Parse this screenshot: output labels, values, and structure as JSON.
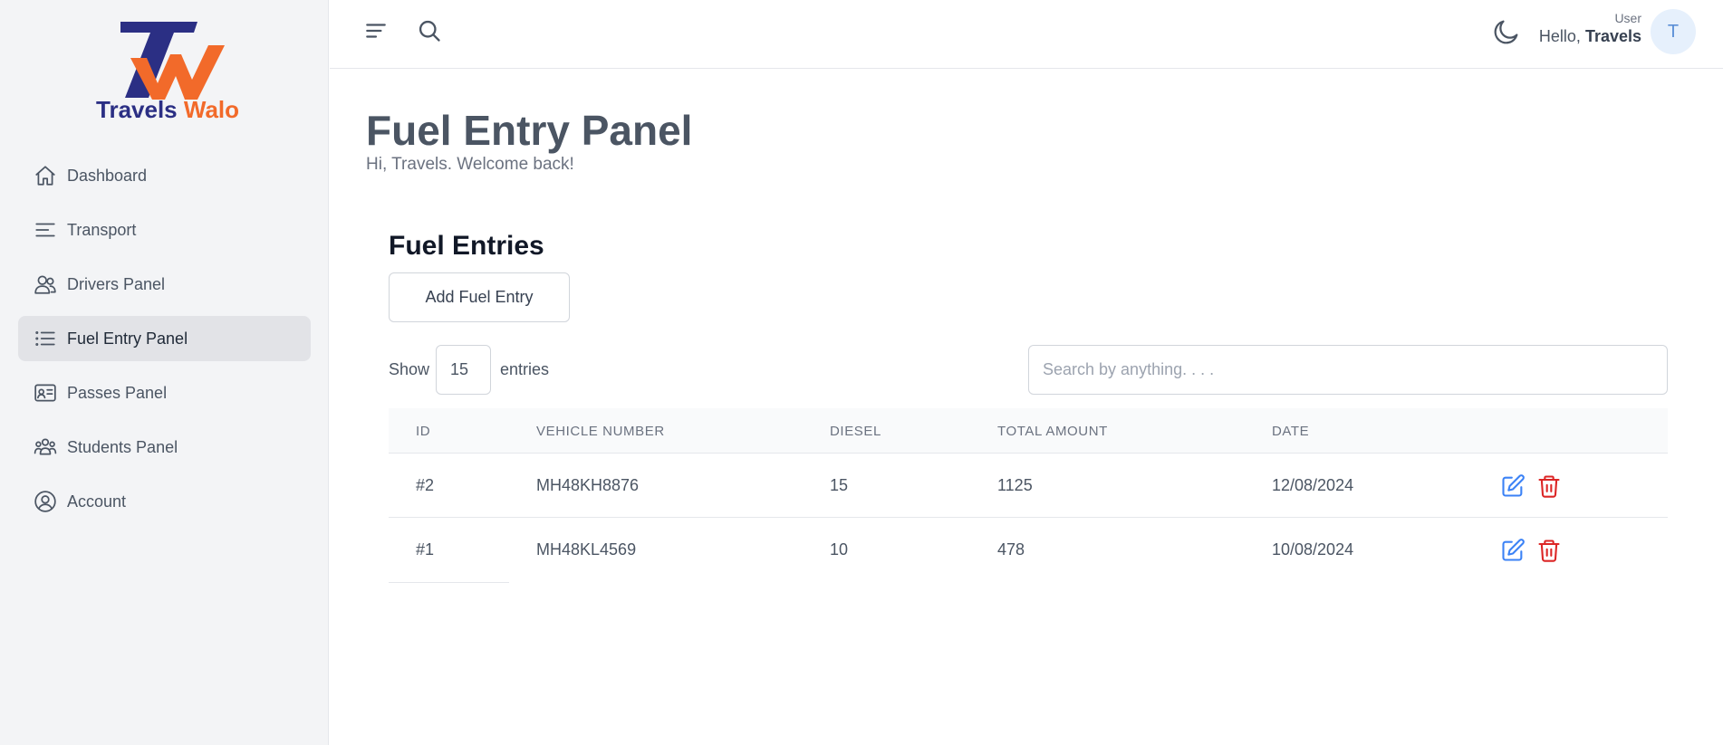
{
  "brand": {
    "name_part1": "Travels",
    "name_part2": "Walo",
    "primary_color": "#2b2f84",
    "accent_color": "#f26a2a"
  },
  "sidebar": {
    "items": [
      {
        "label": "Dashboard",
        "icon": "home-icon",
        "active": false
      },
      {
        "label": "Transport",
        "icon": "lines-icon",
        "active": false
      },
      {
        "label": "Drivers Panel",
        "icon": "users-icon",
        "active": false
      },
      {
        "label": "Fuel Entry Panel",
        "icon": "list-icon",
        "active": true
      },
      {
        "label": "Passes Panel",
        "icon": "id-card-icon",
        "active": false
      },
      {
        "label": "Students Panel",
        "icon": "group-icon",
        "active": false
      },
      {
        "label": "Account",
        "icon": "user-circle-icon",
        "active": false
      }
    ]
  },
  "header": {
    "user_role": "User",
    "greeting": "Hello,",
    "user_name": "Travels",
    "avatar_initial": "T"
  },
  "page": {
    "title": "Fuel Entry Panel",
    "subtitle": "Hi, Travels. Welcome back!"
  },
  "fuel": {
    "section_title": "Fuel Entries",
    "add_button": "Add Fuel Entry",
    "show_label": "Show",
    "entries_value": "15",
    "entries_label": "entries",
    "search_placeholder": "Search by anything. . . .",
    "columns": [
      "ID",
      "VEHICLE NUMBER",
      "DIESEL",
      "TOTAL AMOUNT",
      "DATE"
    ],
    "rows": [
      {
        "id": "#2",
        "vehicle": "MH48KH8876",
        "diesel": "15",
        "amount": "1125",
        "date": "12/08/2024"
      },
      {
        "id": "#1",
        "vehicle": "MH48KL4569",
        "diesel": "10",
        "amount": "478",
        "date": "10/08/2024"
      }
    ],
    "edit_color": "#3b82f6",
    "delete_color": "#dc2626"
  }
}
